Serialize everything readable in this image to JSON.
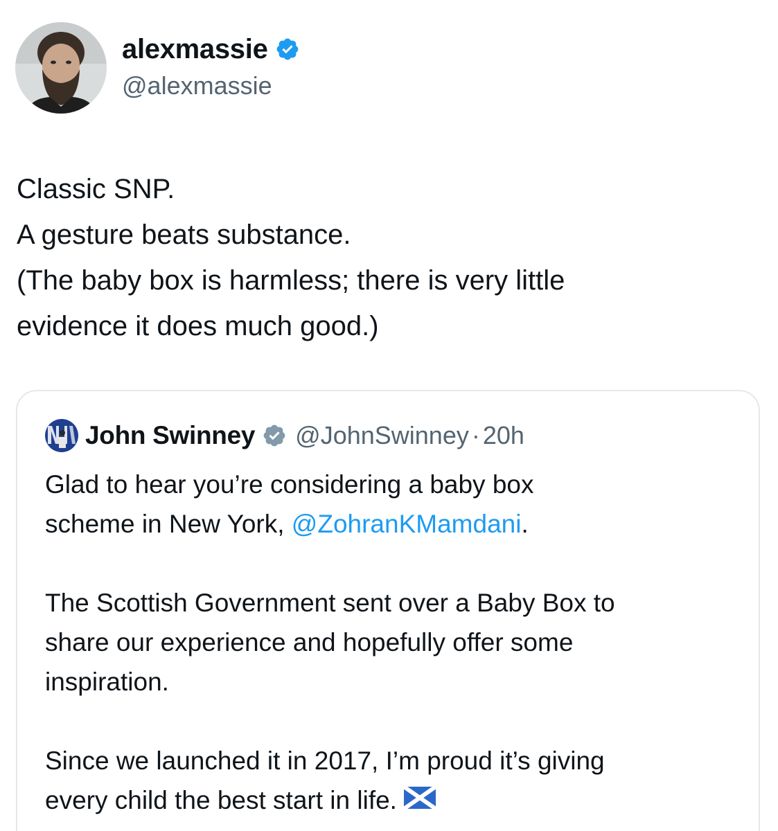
{
  "author": {
    "display_name": "alexmassie",
    "handle": "@alexmassie",
    "avatar_icon": "bearded-man-avatar",
    "verified_icon": "verified-badge-icon",
    "verified_color": "#1d9bf0"
  },
  "tweet": {
    "lines": [
      "Classic SNP.",
      "A gesture beats substance.",
      "(The baby box is harmless; there is very little",
      "evidence it does much good.)"
    ]
  },
  "quoted_tweet": {
    "display_name": "John Swinney",
    "handle": "@JohnSwinney",
    "separator": "·",
    "time": "20h",
    "verified_icon": "government-verified-badge-icon",
    "verified_color": "#829aab",
    "paragraph_1": {
      "line_1": "Glad to hear you’re considering a baby box",
      "line_2_prefix": "scheme in New York, ",
      "mention": "@ZohranKMamdani",
      "line_2_suffix": "."
    },
    "paragraph_2": [
      "The Scottish Government sent over a Baby Box to",
      "share our experience and hopefully offer some",
      "inspiration."
    ],
    "paragraph_3": [
      "Since we launched it in 2017, I’m proud it’s giving",
      "every child the best start in life."
    ],
    "flag_icon": "scotland-flag-icon"
  },
  "colors": {
    "text": "#0f1419",
    "secondary_text": "#536471",
    "link": "#1d9bf0",
    "card_border": "#e3e8ec",
    "flag_blue": "#2b68c8"
  }
}
